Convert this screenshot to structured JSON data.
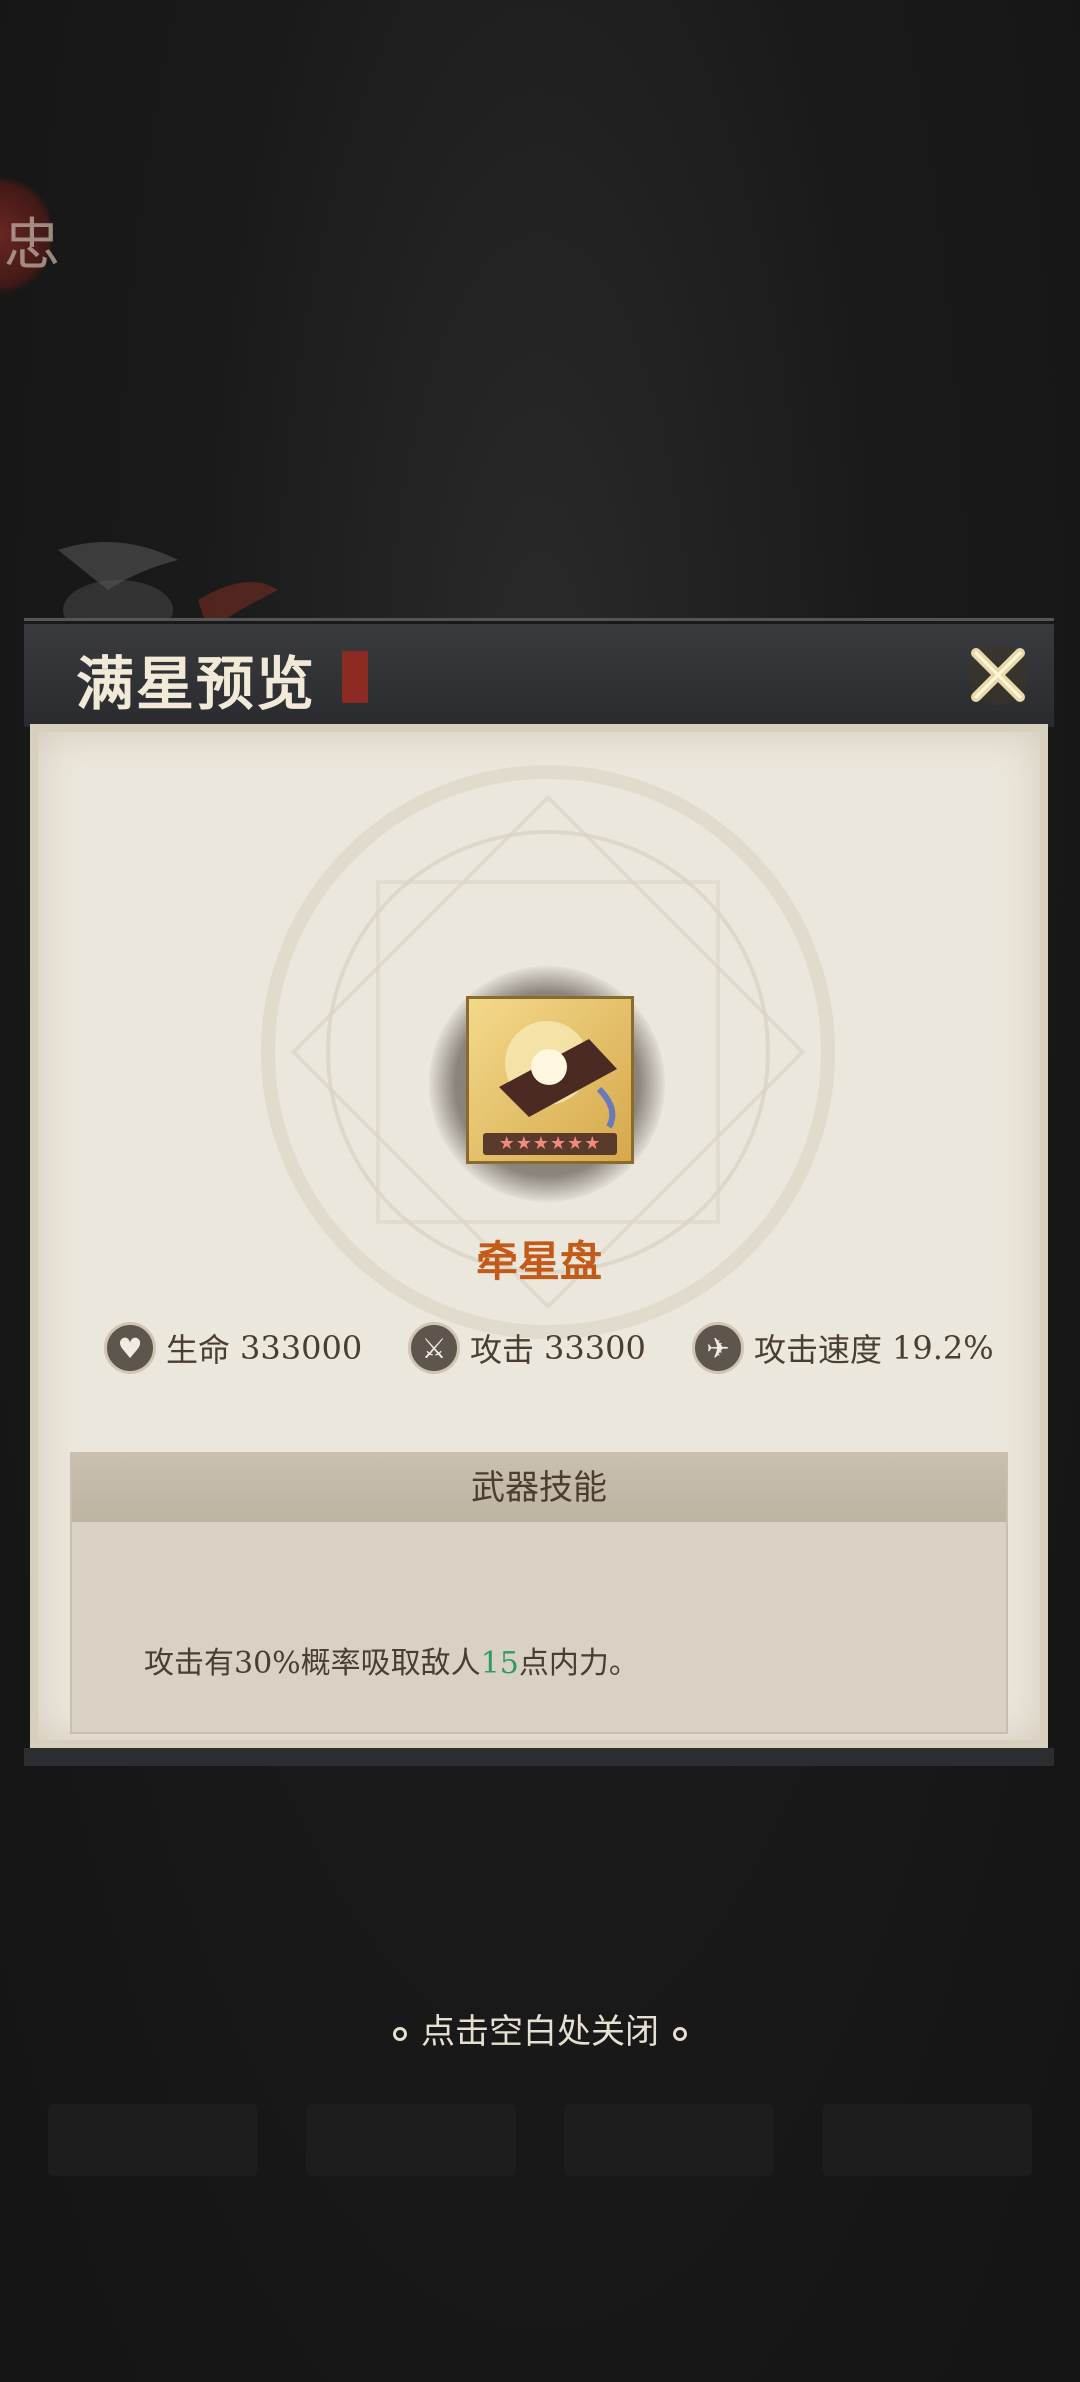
{
  "dialog": {
    "title": "满星预览",
    "item": {
      "name": "牵星盘",
      "stars": "★★★★★★"
    },
    "stats": [
      {
        "icon": "heart-icon",
        "label": "生命",
        "value": "333000"
      },
      {
        "icon": "sword-icon",
        "label": "攻击",
        "value": "33300"
      },
      {
        "icon": "wing-icon",
        "label": "攻击速度",
        "value": "19.2%"
      }
    ],
    "skill": {
      "header": "武器技能",
      "desc_before": "攻击有30%概率吸取敌人",
      "desc_number": "15",
      "desc_after": "点内力。"
    }
  },
  "hint": "点击空白处关闭",
  "colors": {
    "item_name": "#c45a18",
    "highlight_number": "#2e9a6a",
    "panel_bg": "#ece7dc"
  }
}
